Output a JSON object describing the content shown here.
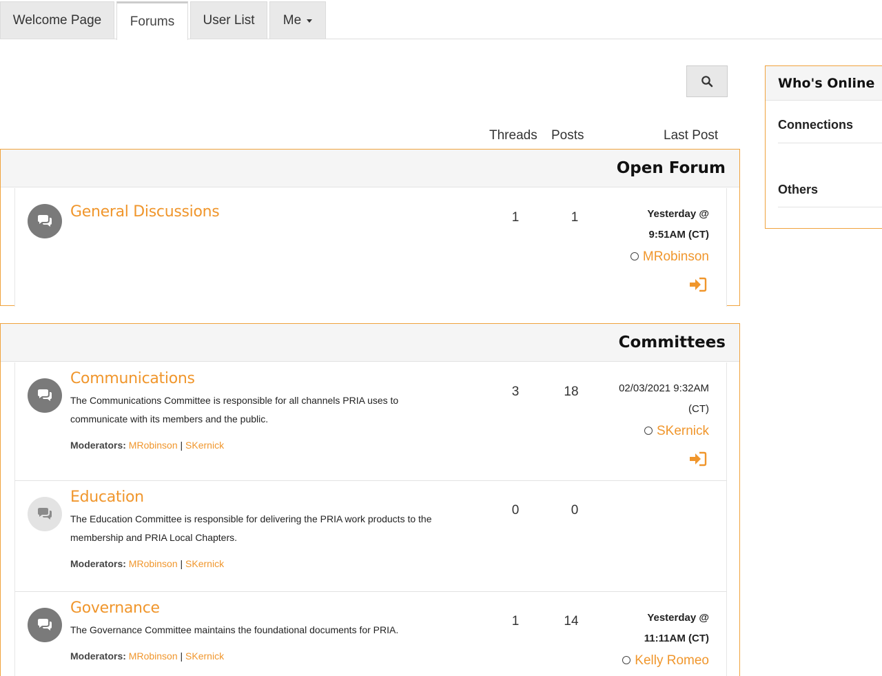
{
  "tabs": [
    {
      "label": "Welcome Page"
    },
    {
      "label": "Forums"
    },
    {
      "label": "User List"
    },
    {
      "label": "Me"
    }
  ],
  "columns": {
    "threads": "Threads",
    "posts": "Posts",
    "last_post": "Last Post"
  },
  "groups": [
    {
      "title": "Open Forum",
      "forums": [
        {
          "title": "General Discussions",
          "threads": "1",
          "posts": "1",
          "last_line1": "Yesterday @",
          "last_line2": "9:51AM (CT)",
          "last_user": "MRobinson"
        }
      ]
    },
    {
      "title": "Committees",
      "forums": [
        {
          "title": "Communications",
          "desc1": "The Communications Committee is responsible for all channels PRIA uses to",
          "desc2": "communicate with its members and the public.",
          "moderators_label": "Moderators:",
          "mod1": "MRobinson",
          "mod2": "SKernick",
          "threads": "3",
          "posts": "18",
          "last_line1": "02/03/2021 9:32AM",
          "last_line2": "(CT)",
          "last_user": "SKernick"
        },
        {
          "title": "Education",
          "desc1": "The Education Committee is responsible for delivering the PRIA work products to the",
          "desc2": "membership and PRIA Local Chapters.",
          "moderators_label": "Moderators:",
          "mod1": "MRobinson",
          "mod2": "SKernick",
          "threads": "0",
          "posts": "0"
        },
        {
          "title": "Governance",
          "desc1": "The Governance Committee maintains the foundational documents for PRIA.",
          "moderators_label": "Moderators:",
          "mod1": "MRobinson",
          "mod2": "SKernick",
          "threads": "1",
          "posts": "14",
          "last_line1": "Yesterday @",
          "last_line2": "11:11AM (CT)",
          "last_user": "Kelly Romeo"
        }
      ]
    }
  ],
  "online": {
    "title": "Who's Online",
    "connections": "Connections",
    "others": "Others"
  },
  "separator": "|",
  "colors": {
    "accent": "#f0962c",
    "border": "#f0a23c"
  }
}
